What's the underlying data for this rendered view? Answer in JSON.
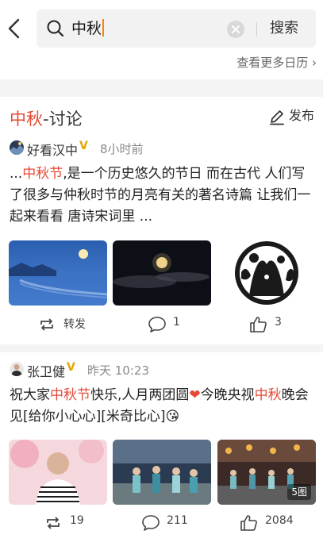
{
  "search": {
    "query": "中秋",
    "submit_label": "搜索"
  },
  "more_calendar_label": "查看更多日历 ›",
  "discussion": {
    "keyword": "中秋",
    "suffix": "-讨论",
    "publish_label": "发布"
  },
  "posts": [
    {
      "author": "好看汉中",
      "verified": "V",
      "time": "8小时前",
      "text_parts": [
        {
          "t": "...",
          "hl": false
        },
        {
          "t": "中秋节",
          "hl": true
        },
        {
          "t": ",是一个历史悠久的节日 而在古代 人们写了很多与仲秋时节的月亮有关的著名诗篇 让我们一起来看看 唐诗宋词里 ...",
          "hl": false
        }
      ],
      "actions": {
        "repost": "转发",
        "comment": "1",
        "like": "3"
      }
    },
    {
      "author": "张卫健",
      "verified": "V",
      "time": "昨天 10:23",
      "text_parts": [
        {
          "t": "祝大家",
          "hl": false
        },
        {
          "t": "中秋节",
          "hl": true
        },
        {
          "t": "快乐,人月两团圆",
          "hl": false
        },
        {
          "t": "❤",
          "hl": true
        },
        {
          "t": "今晚央视",
          "hl": false
        },
        {
          "t": "中秋",
          "hl": true
        },
        {
          "t": "晚会见[给你小心心][米奇比心]",
          "hl": false
        },
        {
          "t": "😘",
          "hl": false
        }
      ],
      "image_count": "5图",
      "actions": {
        "repost": "19",
        "comment": "211",
        "like": "2084"
      }
    }
  ]
}
